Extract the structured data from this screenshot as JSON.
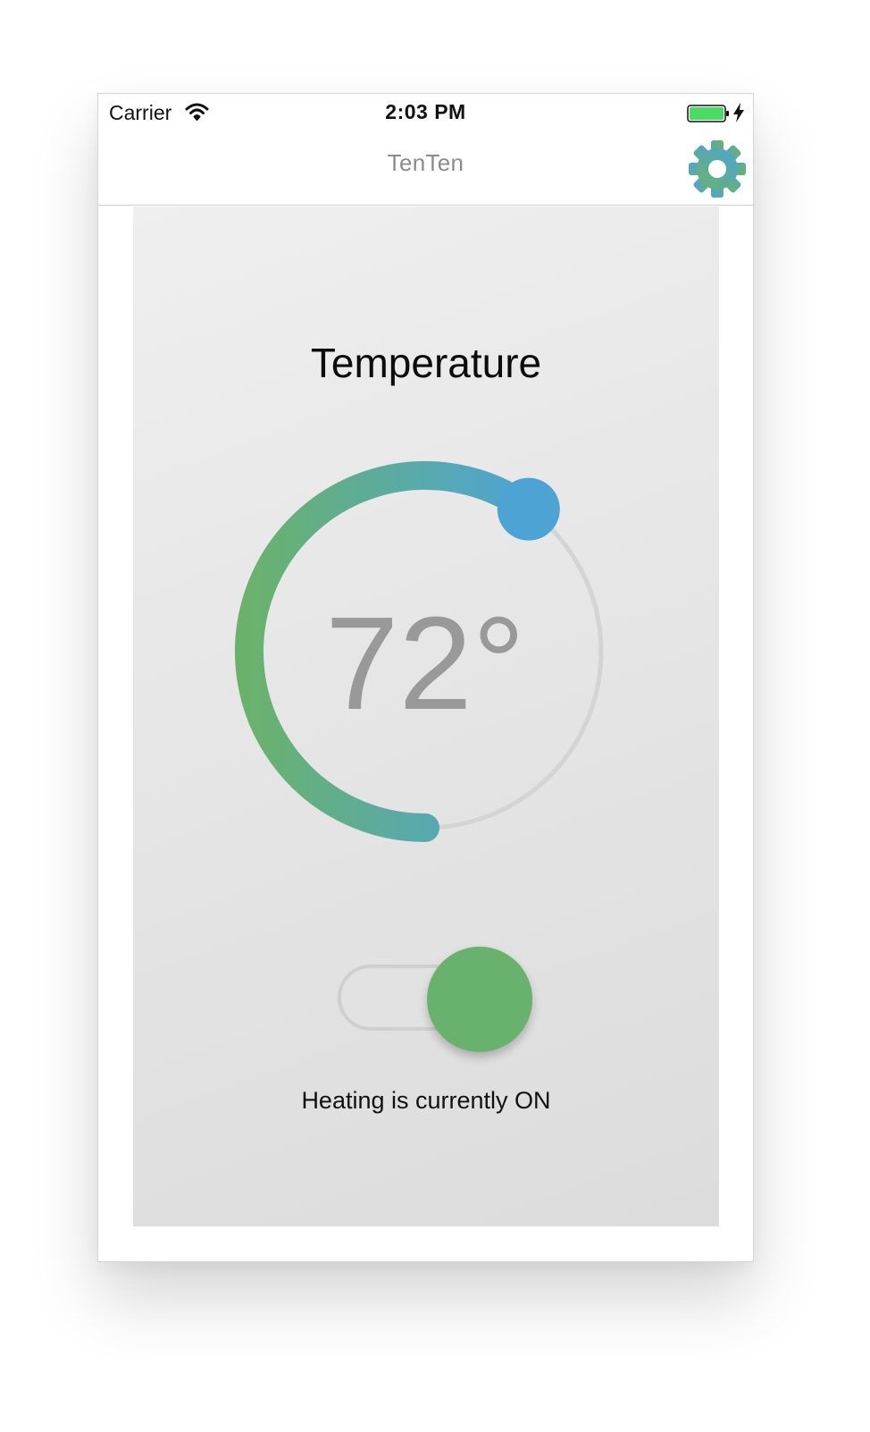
{
  "status_bar": {
    "carrier": "Carrier",
    "time": "2:03 PM",
    "wifi_icon": "wifi-icon",
    "battery_icon": "battery-charging-icon",
    "battery_color": "#4cd964"
  },
  "nav": {
    "title": "TenTen",
    "settings_icon": "gear-icon"
  },
  "thermostat": {
    "title": "Temperature",
    "temperature": "72°",
    "dial_fraction": 0.6,
    "gradient_start": "#6ab26c",
    "gradient_end": "#4da4d4",
    "track_color": "#d4d4d4"
  },
  "heating": {
    "toggle_on": true,
    "toggle_color": "#68b26d",
    "status": "Heating is currently ON"
  }
}
